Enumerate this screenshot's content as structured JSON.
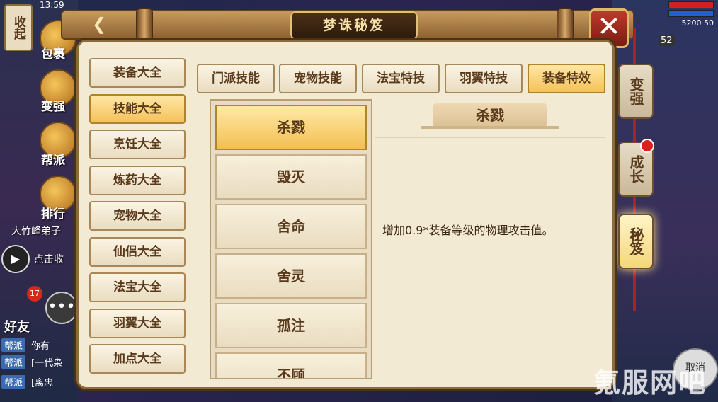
{
  "status_bar": {
    "time": "13:59"
  },
  "title": {
    "text": "梦诛秘笈"
  },
  "left_hud": {
    "collapse_label": "收起",
    "side_labels": [
      "包裹",
      "变强",
      "帮派",
      "排行"
    ],
    "npc_text": "大竹峰弟子",
    "auto_text": "点击收",
    "friends_label": "好友",
    "friends_badge": "17",
    "chat": [
      {
        "tag": "帮派",
        "text": "你有"
      },
      {
        "tag": "帮派",
        "text": "[一代枭"
      },
      {
        "tag": "帮派",
        "text": "[离忠"
      }
    ]
  },
  "right_hud": {
    "level": "52",
    "money": "5200 50",
    "lanterns": [
      "变强",
      "成长",
      "秘笈"
    ],
    "cancel_label": "取消"
  },
  "categories": [
    {
      "label": "装备大全",
      "active": false
    },
    {
      "label": "技能大全",
      "active": true
    },
    {
      "label": "烹饪大全",
      "active": false
    },
    {
      "label": "炼药大全",
      "active": false
    },
    {
      "label": "宠物大全",
      "active": false
    },
    {
      "label": "仙侣大全",
      "active": false
    },
    {
      "label": "法宝大全",
      "active": false
    },
    {
      "label": "羽翼大全",
      "active": false
    },
    {
      "label": "加点大全",
      "active": false
    }
  ],
  "sub_tabs": [
    {
      "label": "门派技能",
      "active": false
    },
    {
      "label": "宠物技能",
      "active": false
    },
    {
      "label": "法宝特技",
      "active": false
    },
    {
      "label": "羽翼特技",
      "active": false
    },
    {
      "label": "装备特效",
      "active": true
    }
  ],
  "skills": [
    {
      "label": "杀戮",
      "active": true
    },
    {
      "label": "毁灭",
      "active": false
    },
    {
      "label": "舍命",
      "active": false
    },
    {
      "label": "舍灵",
      "active": false
    },
    {
      "label": "孤注",
      "active": false
    },
    {
      "label": "不顾",
      "active": false
    }
  ],
  "detail": {
    "title": "杀戮",
    "description": "增加0.9*装备等级的物理攻击值。"
  },
  "watermark": "氪服网吧",
  "colors": {
    "panel_bg": "#f3ead4",
    "active_gold": "#f4c25a",
    "border_brown": "#a88758",
    "text_brown": "#5a3a1c"
  }
}
